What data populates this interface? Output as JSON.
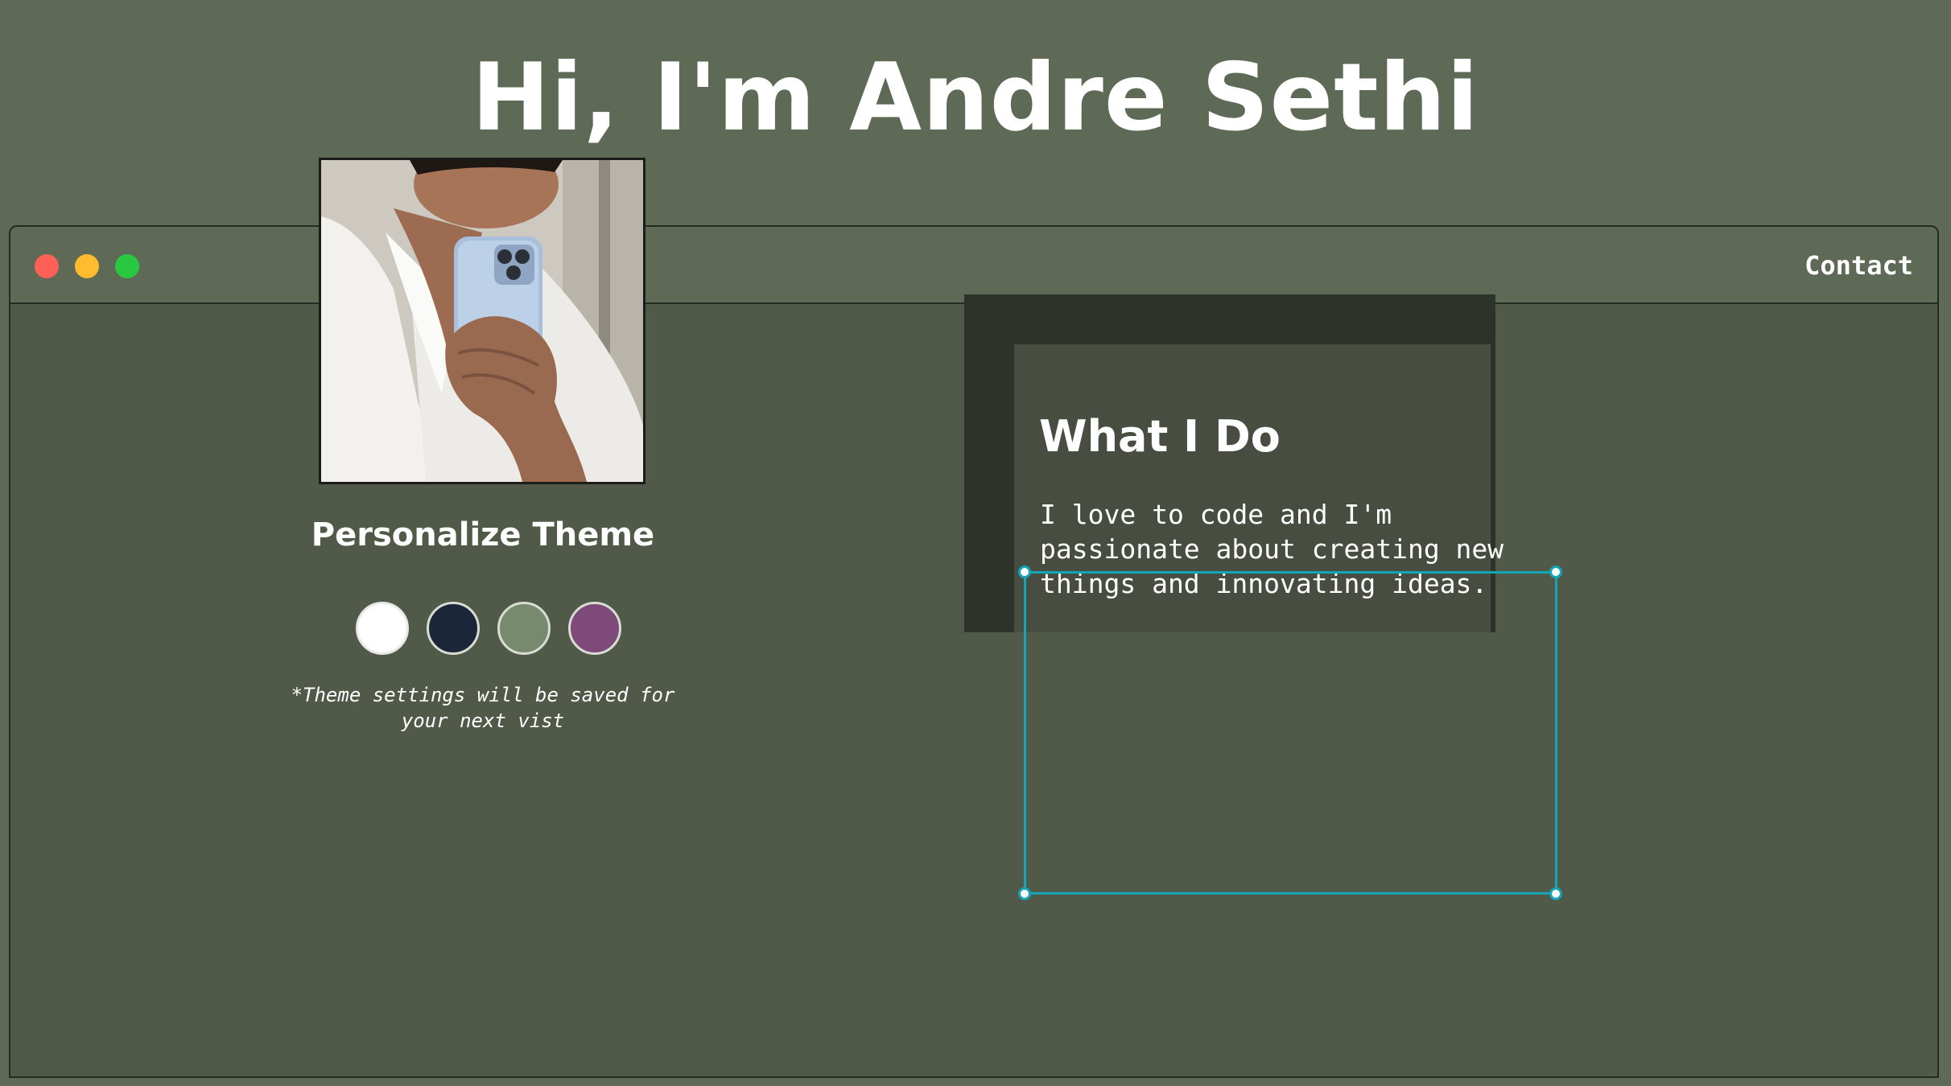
{
  "header": {
    "title": "Hi, I'm Andre Sethi"
  },
  "window": {
    "controls": [
      "close",
      "minimize",
      "maximize"
    ],
    "nav": {
      "contact_label": "Contact"
    }
  },
  "profile": {
    "photo_alt": "Mirror selfie holding a phone",
    "personalize_heading": "Personalize Theme",
    "theme_swatches": [
      {
        "name": "white",
        "color": "#ffffff"
      },
      {
        "name": "navy",
        "color": "#1b2639"
      },
      {
        "name": "sage",
        "color": "#788a6d"
      },
      {
        "name": "plum",
        "color": "#7e4a7a"
      }
    ],
    "theme_note_line1": "*Theme settings will be saved for",
    "theme_note_line2": "your next vist"
  },
  "what_i_do": {
    "heading": "What I Do",
    "line1": "I love to code and I'm",
    "line2": "passionate about creating new",
    "line3": "things and innovating ideas."
  },
  "colors": {
    "page_bg": "#5e6a56",
    "window_bg": "#515a49",
    "card_bg": "#484d41",
    "card_shadow": "#2e3329",
    "selection": "#14a6b8"
  }
}
